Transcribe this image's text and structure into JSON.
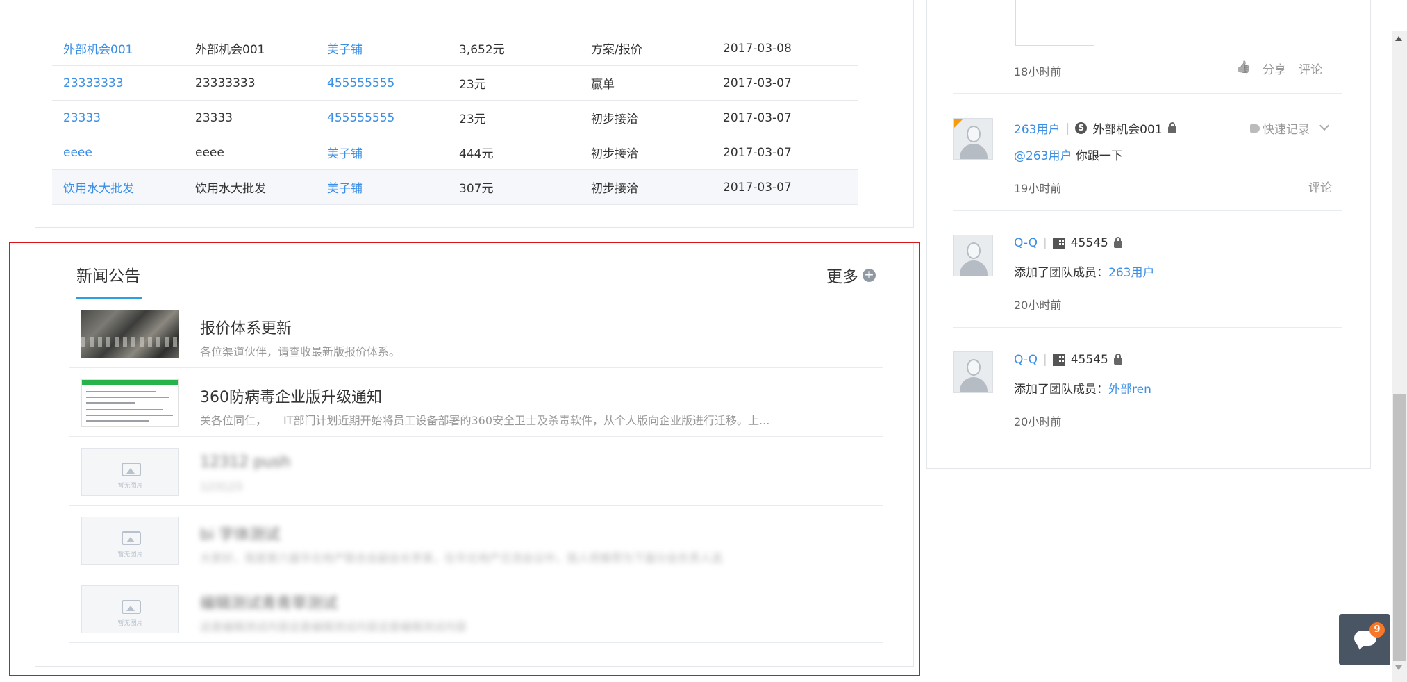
{
  "opportunity_table": {
    "rows": [
      {
        "name": "外部机会001",
        "customer": "外部机会001",
        "owner": "美子铺",
        "amount": "3,652元",
        "stage": "方案/报价",
        "date": "2017-03-08"
      },
      {
        "name": "23333333",
        "customer": "23333333",
        "owner": "455555555",
        "amount": "23元",
        "stage": "赢单",
        "date": "2017-03-07"
      },
      {
        "name": "23333",
        "customer": "23333",
        "owner": "455555555",
        "amount": "23元",
        "stage": "初步接洽",
        "date": "2017-03-07"
      },
      {
        "name": "eeee",
        "customer": "eeee",
        "owner": "美子铺",
        "amount": "444元",
        "stage": "初步接洽",
        "date": "2017-03-07"
      },
      {
        "name": "饮用水大批发",
        "customer": "饮用水大批发",
        "owner": "美子铺",
        "amount": "307元",
        "stage": "初步接洽",
        "date": "2017-03-07"
      }
    ]
  },
  "news": {
    "title": "新闻公告",
    "more_label": "更多",
    "items": [
      {
        "title": "报价体系更新",
        "desc": "各位渠道伙伴，请查收最新版报价体系。",
        "thumb": "stone-photo"
      },
      {
        "title": "360防病毒企业版升级通知",
        "desc": "关各位同仁，　　IT部门计划近期开始将员工设备部署的360安全卫士及杀毒软件，从个人版向企业版进行迁移。上...",
        "thumb": "document-screenshot"
      },
      {
        "title": "12312 push",
        "desc": "123123",
        "thumb": "placeholder",
        "placeholder_caption": "暂无图片"
      },
      {
        "title": "bi 字体测试",
        "desc": "大家好，我是第六届华北地产联合会副会长李某，在华北地产交流会议中，我人将推荐为下届分会负责人选",
        "thumb": "placeholder",
        "placeholder_caption": "暂无图片"
      },
      {
        "title": "编辑测试青青草测试",
        "desc": "这是编辑测试内容这是编辑测试内容这是编辑测试内容",
        "thumb": "placeholder",
        "placeholder_caption": "暂无图片"
      }
    ]
  },
  "feed": {
    "first_time": "18小时前",
    "like_label": "",
    "share_label": "分享",
    "comment_label": "评论",
    "items": [
      {
        "user": "263用户",
        "target": "外部机会001",
        "quick_label": "快速记录",
        "mention": "@263用户",
        "content": " 你跟一下",
        "time": "19小时前",
        "comment_label": "评论"
      },
      {
        "user": "Q-Q",
        "target": "45545",
        "content_prefix": "添加了团队成员：",
        "content_link": "263用户",
        "time": "20小时前"
      },
      {
        "user": "Q-Q",
        "target": "45545",
        "content_prefix": "添加了团队成员：",
        "content_link": "外部ren",
        "time": "20小时前"
      }
    ]
  },
  "chat": {
    "badge": "9"
  },
  "colors": {
    "link": "#3a8ee6",
    "highlight": "#d9161c",
    "tab_underline": "#2d9fe0",
    "badge": "#f5772a"
  }
}
